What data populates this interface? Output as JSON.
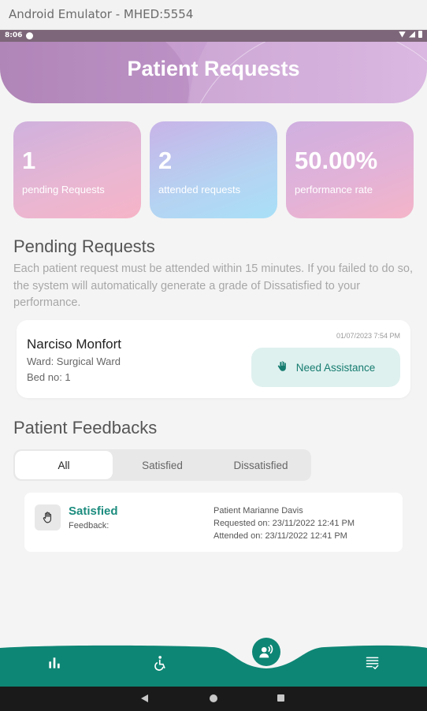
{
  "window": {
    "title": "Android Emulator - MHED:5554"
  },
  "status_bar": {
    "time": "8:06"
  },
  "header": {
    "title": "Patient Requests"
  },
  "stats": [
    {
      "value": "1",
      "label": "pending Requests"
    },
    {
      "value": "2",
      "label": "attended requests"
    },
    {
      "value": "50.00%",
      "label": "performance rate"
    }
  ],
  "pending": {
    "title": "Pending Requests",
    "description": "Each patient request must be attended within 15 minutes. If you failed to do so, the system will automatically generate a grade of Dissatisfied to your performance.",
    "requests": [
      {
        "name": "Narciso Monfort",
        "ward": "Ward: Surgical Ward",
        "bed": "Bed no: 1",
        "datetime": "01/07/2023 7:54 PM",
        "action_label": "Need Assistance"
      }
    ]
  },
  "feedbacks": {
    "title": "Patient Feedbacks",
    "tabs": [
      "All",
      "Satisfied",
      "Dissatisfied"
    ],
    "active_tab": "All",
    "items": [
      {
        "status": "Satisfied",
        "feedback_label": "Feedback:",
        "patient": "Patient Marianne Davis",
        "requested_on": "Requested on: 23/11/2022 12:41 PM",
        "attended_on": "Attended on: 23/11/2022 12:41 PM"
      }
    ]
  },
  "colors": {
    "accent": "#0e8675",
    "header": "#c9a0d2",
    "assist_bg": "#dff1ef"
  },
  "nav": {
    "items": [
      "stats-icon",
      "accessibility-icon",
      "nurse-request-icon",
      "list-check-icon"
    ],
    "active": "nurse-request-icon"
  }
}
